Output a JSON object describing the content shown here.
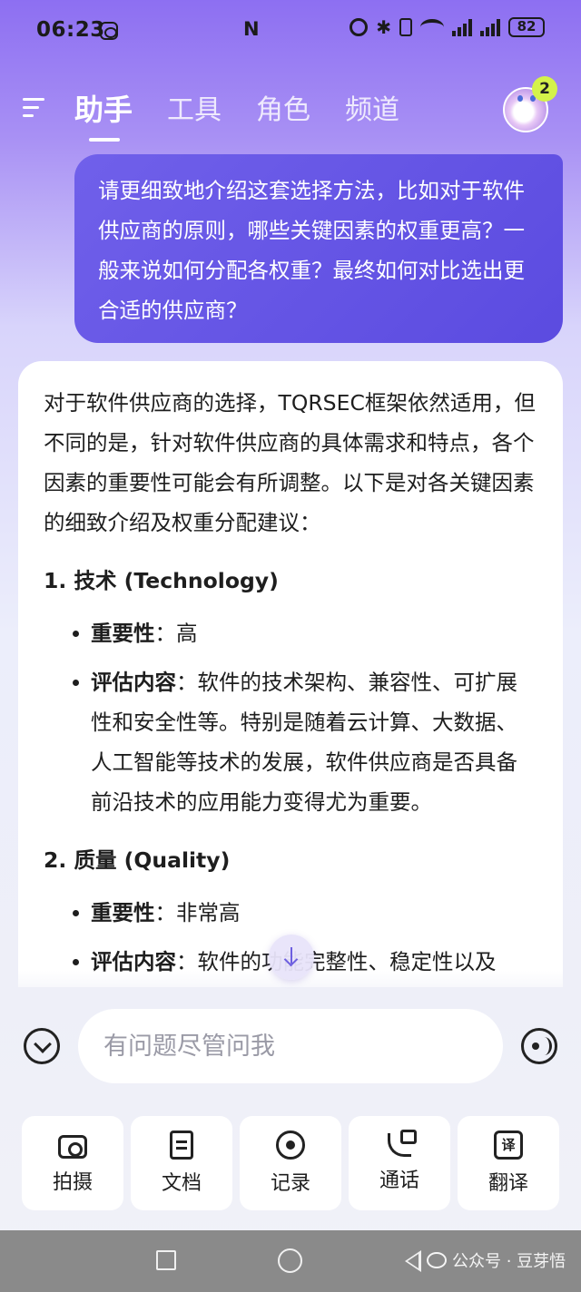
{
  "status_bar": {
    "time": "06:23",
    "nfc": "N",
    "bluetooth": "✱",
    "battery": "82"
  },
  "header": {
    "tabs": [
      {
        "label": "助手",
        "active": true
      },
      {
        "label": "工具",
        "active": false
      },
      {
        "label": "角色",
        "active": false
      },
      {
        "label": "频道",
        "active": false
      }
    ],
    "notification_count": "2"
  },
  "conversation": {
    "user_message": "请更细致地介绍这套选择方法，比如对于软件供应商的原则，哪些关键因素的权重更高？一般来说如何分配各权重？最终如何对比选出更合适的供应商？",
    "answer": {
      "intro": "对于软件供应商的选择，TQRSEC框架依然适用，但不同的是，针对软件供应商的具体需求和特点，各个因素的重要性可能会有所调整。以下是对各关键因素的细致介绍及权重分配建议：",
      "sections": [
        {
          "heading": "1. 技术 (Technology)",
          "bullets": [
            {
              "label": "重要性",
              "sep": "：",
              "text": "高"
            },
            {
              "label": "评估内容",
              "sep": "：",
              "text": "软件的技术架构、兼容性、可扩展性和安全性等。特别是随着云计算、大数据、人工智能等技术的发展，软件供应商是否具备前沿技术的应用能力变得尤为重要。"
            }
          ]
        },
        {
          "heading": "2. 质量 (Quality)",
          "bullets": [
            {
              "label": "重要性",
              "sep": "：",
              "text": "非常高"
            },
            {
              "label": "评估内容",
              "sep": "：",
              "text": "软件的功能完整性、稳定性以及"
            }
          ]
        }
      ]
    }
  },
  "composer": {
    "placeholder": "有问题尽管问我"
  },
  "tools": [
    {
      "label": "拍摄",
      "icon": "camera-icon"
    },
    {
      "label": "文档",
      "icon": "document-icon"
    },
    {
      "label": "记录",
      "icon": "record-icon"
    },
    {
      "label": "通话",
      "icon": "call-icon"
    },
    {
      "label": "翻译",
      "icon": "translate-icon",
      "glyph": "译"
    }
  ],
  "nav_bar": {
    "watermark": "公众号 · 豆芽悟"
  },
  "colors": {
    "accent": "#5b4be0",
    "badge": "#d4f24a",
    "header_gradient_top": "#8d6ff2"
  }
}
